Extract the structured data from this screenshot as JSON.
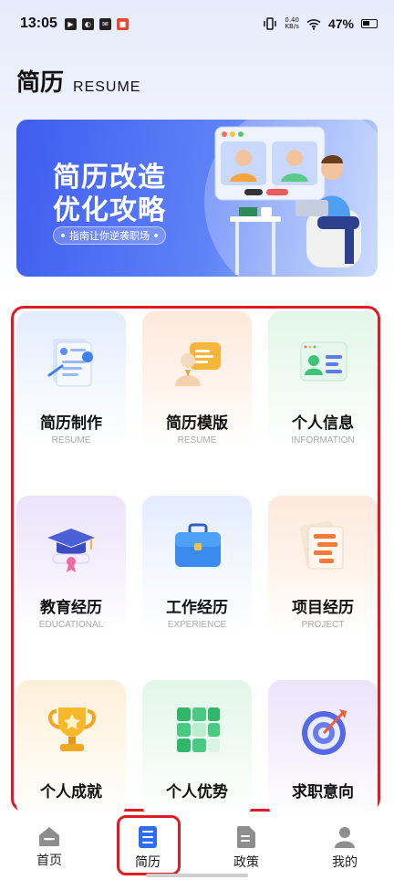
{
  "status_bar": {
    "time": "13:05",
    "net_speed_value": "0.40",
    "net_speed_unit": "KB/s",
    "battery": "47%"
  },
  "header": {
    "title_cn": "简历",
    "title_en": "RESUME"
  },
  "banner": {
    "line1": "简历改造",
    "line2": "优化攻略",
    "pill": "指南让你逆袭职场"
  },
  "cards": [
    {
      "title": "简历制作",
      "subtitle": "RESUME",
      "icon": "resume-document-icon"
    },
    {
      "title": "简历模版",
      "subtitle": "RESUME",
      "icon": "resume-template-icon"
    },
    {
      "title": "个人信息",
      "subtitle": "INFORMATION",
      "icon": "personal-info-icon"
    },
    {
      "title": "教育经历",
      "subtitle": "EDUCATIONAL",
      "icon": "graduation-cap-icon"
    },
    {
      "title": "工作经历",
      "subtitle": "EXPERIENCE",
      "icon": "briefcase-icon"
    },
    {
      "title": "项目经历",
      "subtitle": "PROJECT",
      "icon": "project-document-icon"
    },
    {
      "title": "个人成就",
      "subtitle": "",
      "icon": "trophy-icon"
    },
    {
      "title": "个人优势",
      "subtitle": "",
      "icon": "blocks-icon"
    },
    {
      "title": "求职意向",
      "subtitle": "",
      "icon": "target-icon"
    }
  ],
  "nav": {
    "items": [
      {
        "label": "首页",
        "icon": "home-icon"
      },
      {
        "label": "简历",
        "icon": "resume-icon"
      },
      {
        "label": "政策",
        "icon": "policy-doc-icon"
      },
      {
        "label": "我的",
        "icon": "profile-icon"
      }
    ],
    "active": "简历"
  },
  "colors": {
    "accent": "#2f6df6",
    "highlight_border": "#e01b24"
  }
}
